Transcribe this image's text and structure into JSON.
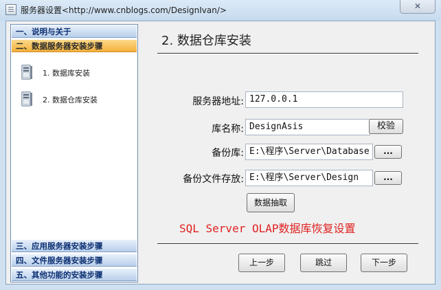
{
  "window": {
    "title": "服务器设置<http://www.cnblogs.com/DesignIvan/>",
    "close_label": "✕"
  },
  "sidebar": {
    "sections": [
      {
        "label": "一、说明与关于"
      },
      {
        "label": "二、数据服务器安装步骤",
        "active": true
      },
      {
        "label": "三、应用服务器安装步骤"
      },
      {
        "label": "四、文件服务器安装步骤"
      },
      {
        "label": "五、其他功能的安装步骤"
      }
    ],
    "subitems": [
      {
        "label": "1. 数据库安装",
        "icon": "database-server-icon"
      },
      {
        "label": "2. 数据仓库安装",
        "icon": "database-server-icon"
      }
    ]
  },
  "main": {
    "title": "2. 数据仓库安装",
    "fields": {
      "server_address": {
        "label": "服务器地址:",
        "value": "127.0.0.1"
      },
      "db_name": {
        "label": "库名称:",
        "value": "DesignAsis",
        "button": "校验"
      },
      "backup_db": {
        "label": "备份库:",
        "value": "E:\\程序\\Server\\Database",
        "button": "..."
      },
      "backup_storage": {
        "label": "备份文件存放:",
        "value": "E:\\程序\\Server\\Design",
        "button": "..."
      }
    },
    "extract_button": "数据抽取",
    "note": "SQL Server OLAP数据库恢复设置",
    "buttons": {
      "prev": "上一步",
      "skip": "跳过",
      "next": "下一步"
    }
  },
  "colors": {
    "active_section": "#f5b13c",
    "section_header": "#b9cfeb",
    "note_text": "#e02020"
  }
}
